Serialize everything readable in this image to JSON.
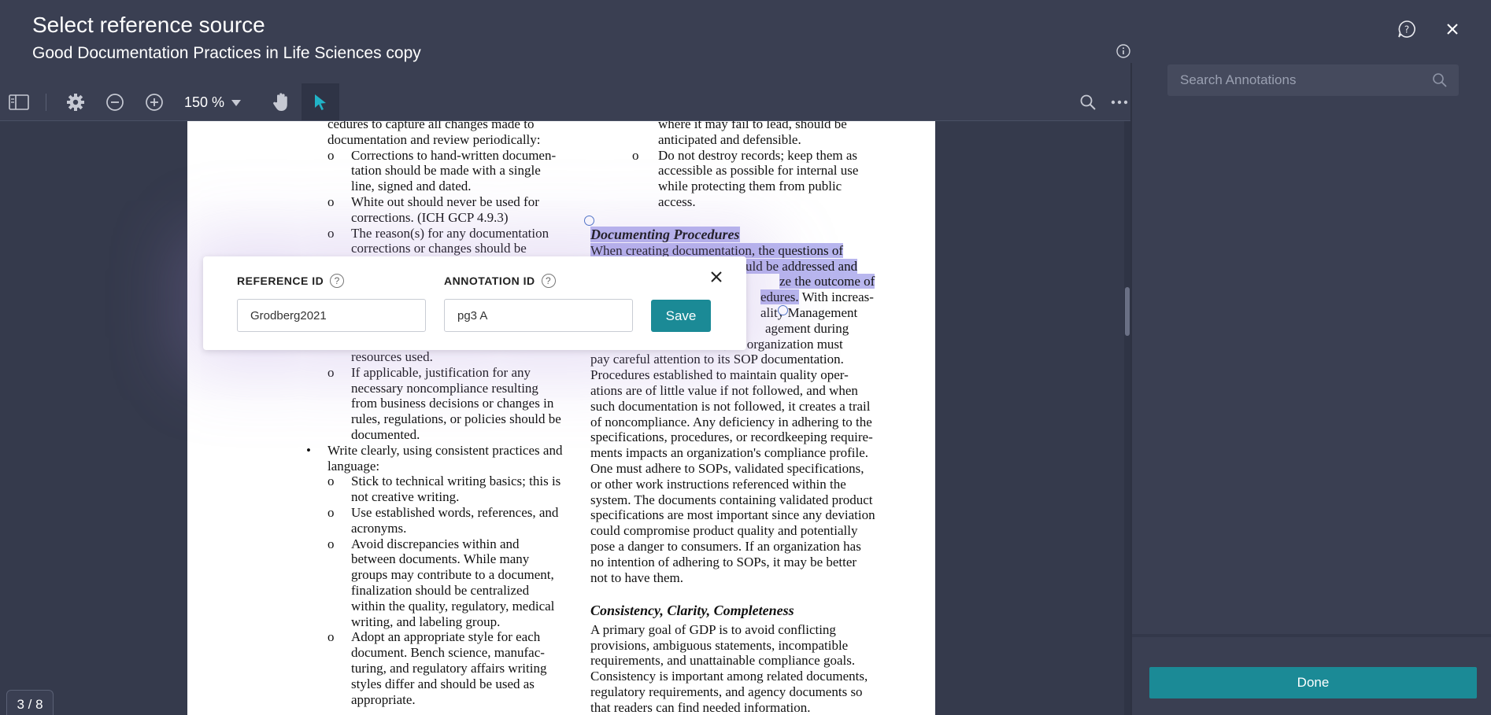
{
  "header": {
    "title": "Select reference source",
    "subtitle": "Good Documentation Practices in Life Sciences copy"
  },
  "toolbar": {
    "zoom_level": "150 %"
  },
  "search": {
    "placeholder": "Search Annotations"
  },
  "popup": {
    "reference_label": "REFERENCE ID",
    "annotation_label": "ANNOTATION ID",
    "reference_value": "Grodberg2021",
    "annotation_value": "pg3 A",
    "save_label": "Save"
  },
  "done_label": "Done",
  "page_indicator": "3 / 8",
  "document": {
    "left_lines": [
      "cedures to capture all changes made to",
      "documentation and review periodically:",
      "Corrections to hand-written documen-",
      "tation should be made with a single",
      "line, signed and dated.",
      "White out should never be used for",
      "corrections. (ICH GCP 4.9.3)",
      "The reason(s) for any documentation",
      "corrections or changes should be",
      "resources used.",
      "If applicable, justification for any",
      "necessary noncompliance resulting",
      "from business decisions or changes in",
      "rules, regulations, or policies should be",
      "documented.",
      "Write clearly, using consistent practices and",
      "language:",
      "Stick to technical writing basics; this is",
      "not creative writing.",
      "Use established words, references, and",
      "acronyms.",
      "Avoid discrepancies within and",
      "between documents. While many",
      "groups may contribute to a document,",
      "finalization should be centralized",
      "within the quality, regulatory, medical",
      "writing, and labeling group.",
      "Adopt an appropriate style for each",
      "document. Bench science, manufac-",
      "turing, and regulatory affairs writing",
      "styles differ and should be used as",
      "appropriate."
    ],
    "right_top_lines": [
      "where it may fail to lead, should be",
      "anticipated and defensible.",
      "Do not destroy records; keep them as",
      "accessible as possible for internal use",
      "while protecting them from public",
      "access."
    ],
    "section1_heading": "Documenting Procedures",
    "section1_lines": [
      "When creating documentation, the questions of",
      "uld be addressed and",
      "ze the outcome of",
      "edures.",
      " With increas-",
      "ality Management",
      "agement during",
      ", an organization must",
      "pay careful attention to its SOP documentation.",
      "Procedures established to maintain quality oper-",
      "ations are of little value if not followed, and when",
      "such documentation is not followed, it creates a trail",
      "of noncompliance. Any deficiency in adhering to the",
      "specifications, procedures, or recordkeeping require-",
      "ments impacts an organization's compliance profile.",
      "One must adhere to SOPs, validated specifications,",
      "or other work instructions referenced within the",
      "system. The documents containing validated product",
      "specifications are most important since any deviation",
      "could compromise product quality and potentially",
      "pose a danger to consumers. If an organization has",
      "no intention of adhering to SOPs, it may be better",
      "not to have them."
    ],
    "section2_heading": "Consistency, Clarity, Completeness",
    "section2_lines": [
      "A primary goal of GDP is to avoid conflicting",
      "provisions, ambiguous statements, incompatible",
      "requirements, and unattainable compliance goals.",
      "Consistency is important among related documents,",
      "regulatory requirements, and agency documents so",
      "that readers can find needed information."
    ]
  },
  "colors": {
    "background": "#3a3f52",
    "accent": "#1b8a96",
    "highlight": "#b8b6ee"
  },
  "icons": [
    "help-icon",
    "close-icon",
    "info-icon",
    "sidebar-toggle-icon",
    "gear-icon",
    "zoom-out-icon",
    "zoom-in-icon",
    "chevron-down-icon",
    "hand-icon",
    "pointer-icon",
    "search-icon",
    "more-icon"
  ]
}
